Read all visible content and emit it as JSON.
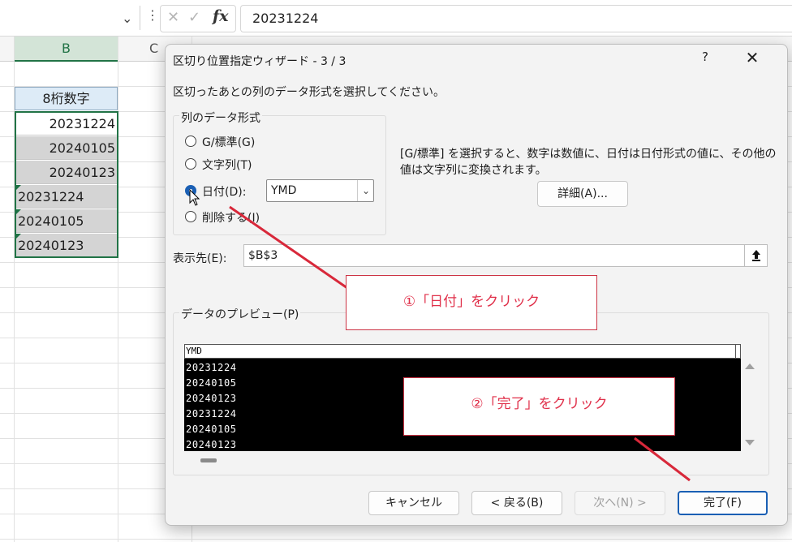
{
  "formula_bar": {
    "dots": "⋮",
    "cancel_icon": "✕",
    "enter_icon": "✓",
    "fx": "fx",
    "value": "20231224"
  },
  "sheet": {
    "columns": [
      "B",
      "C"
    ],
    "header_cell": "8桁数字",
    "cells": [
      "20231224",
      "20240105",
      "20240123",
      "20231224",
      "20240105",
      "20240123"
    ]
  },
  "dialog": {
    "title": "区切り位置指定ウィザード - 3 / 3",
    "help": "?",
    "close": "✕",
    "instruction": "区切ったあとの列のデータ形式を選択してください。",
    "format_group_label": "列のデータ形式",
    "radios": [
      {
        "label": "G/標準(G)",
        "checked": false
      },
      {
        "label": "文字列(T)",
        "checked": false
      },
      {
        "label": "日付(D):",
        "checked": true
      },
      {
        "label": "削除する(I)",
        "checked": false
      }
    ],
    "date_format": "YMD",
    "description": "[G/標準] を選択すると、数字は数値に、日付は日付形式の値に、その他の値は文字列に変換されます。",
    "advanced_button": "詳細(A)...",
    "destination_label": "表示先(E):",
    "destination_value": "$B$3",
    "preview_label": "データのプレビュー(P)",
    "preview_header": "YMD",
    "preview_rows": [
      "20231224",
      "20240105",
      "20240123",
      "20231224",
      "20240105",
      "20240123"
    ],
    "buttons": {
      "cancel": "キャンセル",
      "back": "< 戻る(B)",
      "next": "次へ(N) >",
      "finish": "完了(F)"
    }
  },
  "annotations": {
    "callout_1": "①「日付」をクリック",
    "callout_2": "②「完了」をクリック",
    "accent_color": "#e0304a"
  }
}
